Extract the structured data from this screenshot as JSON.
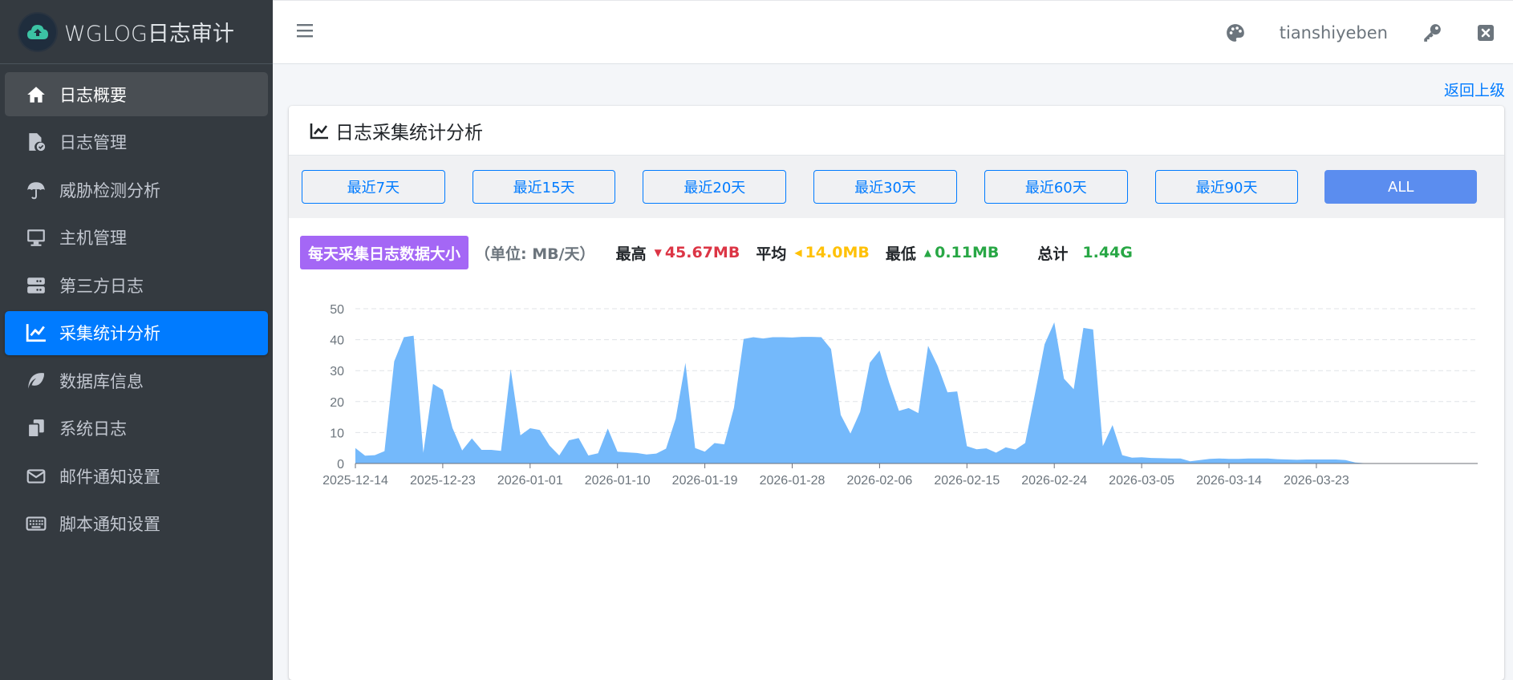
{
  "app": {
    "brand": "WGLOG日志审计"
  },
  "sidebar": {
    "items": [
      {
        "label": "日志概要",
        "icon": "home-icon"
      },
      {
        "label": "日志管理",
        "icon": "file-check-icon"
      },
      {
        "label": "威胁检测分析",
        "icon": "umbrella-icon"
      },
      {
        "label": "主机管理",
        "icon": "desktop-icon"
      },
      {
        "label": "第三方日志",
        "icon": "server-icon"
      },
      {
        "label": "采集统计分析",
        "icon": "chart-line-icon"
      },
      {
        "label": "数据库信息",
        "icon": "leaf-icon"
      },
      {
        "label": "系统日志",
        "icon": "copy-icon"
      },
      {
        "label": "邮件通知设置",
        "icon": "envelope-icon"
      },
      {
        "label": "脚本通知设置",
        "icon": "keyboard-icon"
      }
    ],
    "active_index": 5,
    "hover_index": 0
  },
  "topbar": {
    "username": "tianshiyeben"
  },
  "page": {
    "back_link": "返回上级",
    "card_title": "日志采集统计分析"
  },
  "filters": [
    "最近7天",
    "最近15天",
    "最近20天",
    "最近30天",
    "最近60天",
    "最近90天",
    "ALL"
  ],
  "stats": {
    "badge": "每天采集日志数据大小",
    "unit": "（单位: MB/天）",
    "max_label": "最高",
    "max_value": "45.67MB",
    "avg_label": "平均",
    "avg_value": "14.0MB",
    "min_label": "最低",
    "min_value": "0.11MB",
    "total_label": "总计",
    "total_value": "1.44G"
  },
  "colors": {
    "accent": "#007bff",
    "area": "#74b9fb",
    "badge": "#a467f5"
  },
  "chart_data": {
    "type": "area",
    "x_start": "2025-12-14",
    "x_ticks": [
      "2025-12-14",
      "2025-12-23",
      "2026-01-01",
      "2026-01-10",
      "2026-01-19",
      "2026-01-28",
      "2026-02-06",
      "2026-02-15",
      "2026-02-24",
      "2026-03-05",
      "2026-03-14",
      "2026-03-23"
    ],
    "y_ticks": [
      0,
      10,
      20,
      30,
      40,
      50
    ],
    "ylim": [
      0,
      50
    ],
    "grid": true,
    "values": [
      5.0,
      2.5,
      2.7,
      4.0,
      33.0,
      40.8,
      41.3,
      3.5,
      25.7,
      23.8,
      11.5,
      4.2,
      8.1,
      4.4,
      4.4,
      4.1,
      30.5,
      9.1,
      11.4,
      10.8,
      5.8,
      2.6,
      7.5,
      8.2,
      2.6,
      3.3,
      11.3,
      3.8,
      3.6,
      3.4,
      2.9,
      3.2,
      4.8,
      14.5,
      32.5,
      5.0,
      3.8,
      6.6,
      6.2,
      18.0,
      40.2,
      40.8,
      40.4,
      40.8,
      40.8,
      40.7,
      40.9,
      40.9,
      40.8,
      37.0,
      15.7,
      9.7,
      16.7,
      32.6,
      36.5,
      26.0,
      17.0,
      17.9,
      16.3,
      38.0,
      31.5,
      23.0,
      23.3,
      5.6,
      4.6,
      4.9,
      3.5,
      5.2,
      4.5,
      6.6,
      22.3,
      38.5,
      45.6,
      27.4,
      24.0,
      43.8,
      43.3,
      5.6,
      12.4,
      2.7,
      1.9,
      2.0,
      1.8,
      1.7,
      1.6,
      1.6,
      0.7,
      1.1,
      1.5,
      1.6,
      1.5,
      1.5,
      1.6,
      1.6,
      1.6,
      1.4,
      1.3,
      1.2,
      1.3,
      1.3,
      1.3,
      1.3,
      1.1,
      0.3,
      0.11
    ]
  }
}
